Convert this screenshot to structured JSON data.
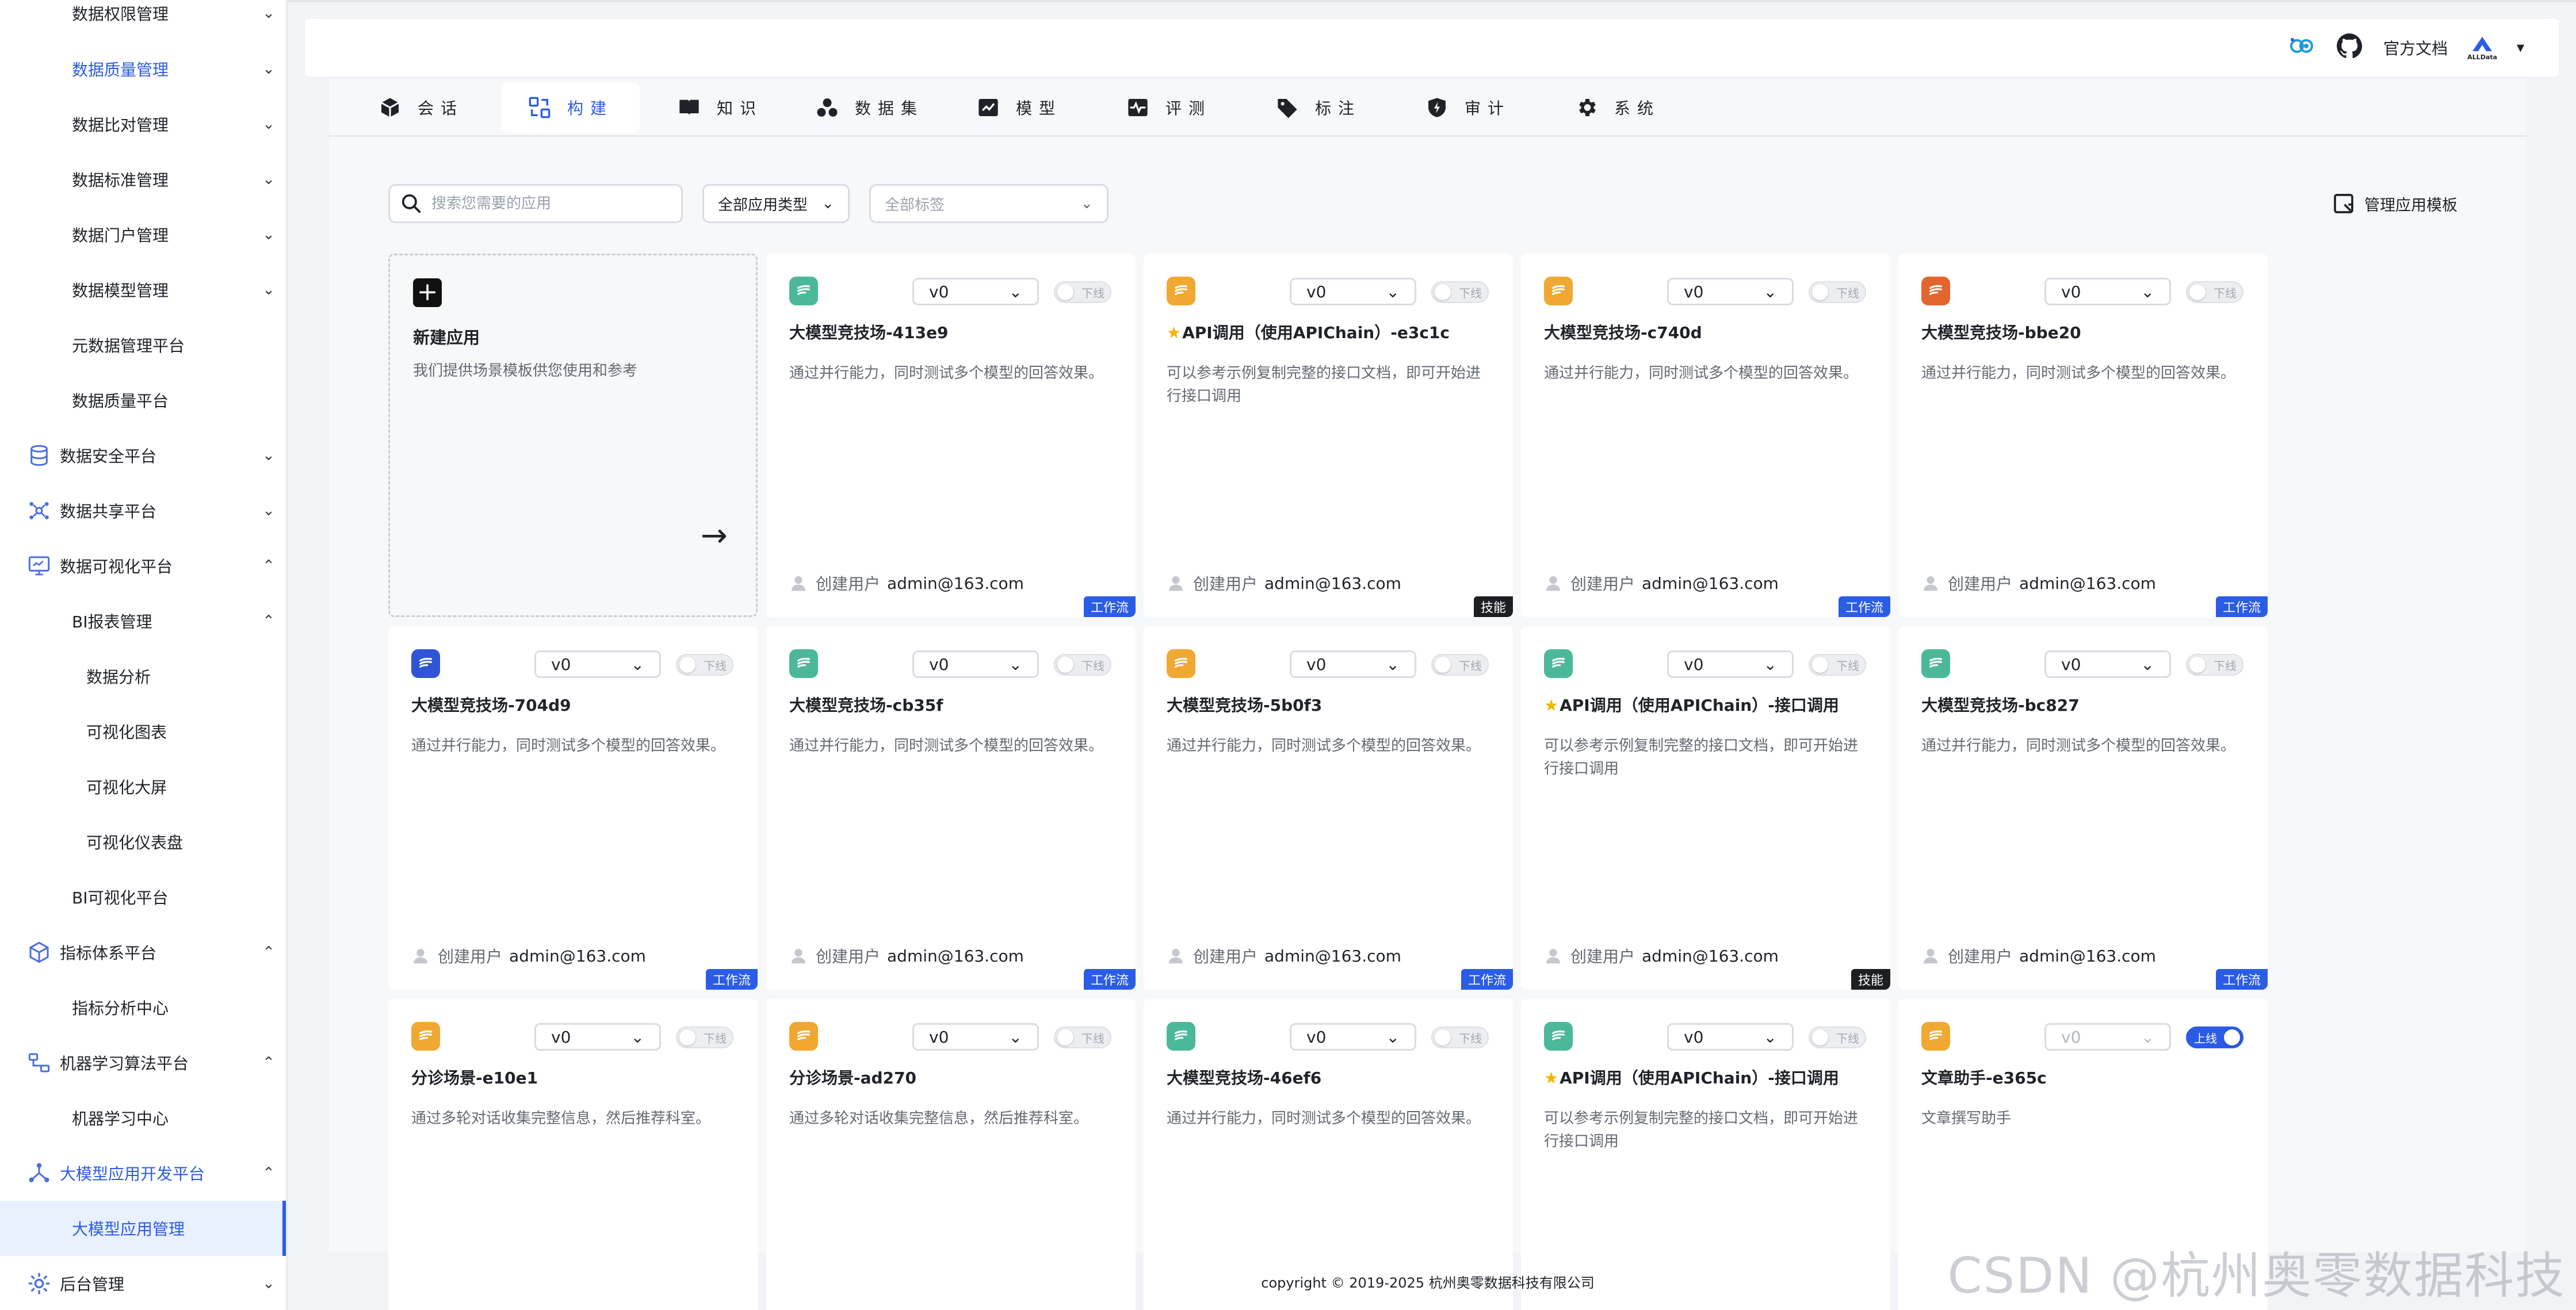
{
  "sidebar": {
    "items": [
      {
        "label": "数据权限管理",
        "level": "sub",
        "chevron": "down"
      },
      {
        "label": "数据质量管理",
        "level": "sub",
        "chevron": "down",
        "highlight": true
      },
      {
        "label": "数据比对管理",
        "level": "sub",
        "chevron": "down"
      },
      {
        "label": "数据标准管理",
        "level": "sub",
        "chevron": "down"
      },
      {
        "label": "数据门户管理",
        "level": "sub",
        "chevron": "down"
      },
      {
        "label": "数据模型管理",
        "level": "sub",
        "chevron": "down"
      },
      {
        "label": "元数据管理平台",
        "level": "sub"
      },
      {
        "label": "数据质量平台",
        "level": "sub"
      },
      {
        "label": "数据安全平台",
        "level": "top",
        "icon": "database-icon",
        "chevron": "down"
      },
      {
        "label": "数据共享平台",
        "level": "top",
        "icon": "network-icon",
        "chevron": "down"
      },
      {
        "label": "数据可视化平台",
        "level": "top",
        "icon": "monitor-icon",
        "chevron": "up"
      },
      {
        "label": "BI报表管理",
        "level": "sub",
        "chevron": "up"
      },
      {
        "label": "数据分析",
        "level": "sub2"
      },
      {
        "label": "可视化图表",
        "level": "sub2"
      },
      {
        "label": "可视化大屏",
        "level": "sub2"
      },
      {
        "label": "可视化仪表盘",
        "level": "sub2"
      },
      {
        "label": "BI可视化平台",
        "level": "sub"
      },
      {
        "label": "指标体系平台",
        "level": "top",
        "icon": "cube-icon",
        "chevron": "up"
      },
      {
        "label": "指标分析中心",
        "level": "sub"
      },
      {
        "label": "机器学习算法平台",
        "level": "top",
        "icon": "algorithm-icon",
        "chevron": "up"
      },
      {
        "label": "机器学习中心",
        "level": "sub"
      },
      {
        "label": "大模型应用开发平台",
        "level": "top",
        "icon": "nodes-icon",
        "chevron": "up",
        "highlight": true
      },
      {
        "label": "大模型应用管理",
        "level": "sub",
        "active": true
      },
      {
        "label": "后台管理",
        "level": "top",
        "icon": "settings-icon",
        "chevron": "down"
      }
    ]
  },
  "header": {
    "docs_label": "官方文档",
    "logo_text": "ALLData",
    "menu_arrow": "▾"
  },
  "tabs": [
    {
      "label": "会话",
      "icon": "cube-icon"
    },
    {
      "label": "构建",
      "icon": "build-icon",
      "active": true
    },
    {
      "label": "知识",
      "icon": "book-icon"
    },
    {
      "label": "数据集",
      "icon": "dataset-icon"
    },
    {
      "label": "模型",
      "icon": "model-icon"
    },
    {
      "label": "评测",
      "icon": "pulse-icon"
    },
    {
      "label": "标注",
      "icon": "tag-icon"
    },
    {
      "label": "审计",
      "icon": "shield-icon"
    },
    {
      "label": "系统",
      "icon": "gear-icon"
    }
  ],
  "filters": {
    "search_placeholder": "搜索您需要的应用",
    "type_select": "全部应用类型",
    "tag_select": "全部标签",
    "manage_label": "管理应用模板"
  },
  "new_card": {
    "title": "新建应用",
    "desc": "我们提供场景模板供您使用和参考",
    "plus": "+",
    "arrow": "→"
  },
  "card_common": {
    "creator_label": "创建用户",
    "toggle_off": "下线",
    "toggle_on": "上线",
    "chevron": "⌄"
  },
  "cards": [
    {
      "title": "大模型竞技场-413e9",
      "star": "",
      "desc": "通过并行能力，同时测试多个模型的回答效果。",
      "version": "v0",
      "status": "下线",
      "on": false,
      "creator": "admin@163.com",
      "badge": "工作流",
      "badge_dark": false,
      "icon_color": "#4bb89a"
    },
    {
      "title": "API调用（使用APIChain）-e3c1c",
      "star": "★",
      "desc": "可以参考示例复制完整的接口文档，即可开始进行接口调用",
      "version": "v0",
      "status": "下线",
      "on": false,
      "creator": "admin@163.com",
      "badge": "技能",
      "badge_dark": true,
      "icon_color": "#f0a832"
    },
    {
      "title": "大模型竞技场-c740d",
      "star": "",
      "desc": "通过并行能力，同时测试多个模型的回答效果。",
      "version": "v0",
      "status": "下线",
      "on": false,
      "creator": "admin@163.com",
      "badge": "工作流",
      "badge_dark": false,
      "icon_color": "#f0a832"
    },
    {
      "title": "大模型竞技场-bbe20",
      "star": "",
      "desc": "通过并行能力，同时测试多个模型的回答效果。",
      "version": "v0",
      "status": "下线",
      "on": false,
      "creator": "admin@163.com",
      "badge": "工作流",
      "badge_dark": false,
      "icon_color": "#e2652e"
    },
    {
      "title": "大模型竞技场-704d9",
      "star": "",
      "desc": "通过并行能力，同时测试多个模型的回答效果。",
      "version": "v0",
      "status": "下线",
      "on": false,
      "creator": "admin@163.com",
      "badge": "工作流",
      "badge_dark": false,
      "icon_color": "#2f55d4"
    },
    {
      "title": "大模型竞技场-cb35f",
      "star": "",
      "desc": "通过并行能力，同时测试多个模型的回答效果。",
      "version": "v0",
      "status": "下线",
      "on": false,
      "creator": "admin@163.com",
      "badge": "工作流",
      "badge_dark": false,
      "icon_color": "#4bb89a"
    },
    {
      "title": "大模型竞技场-5b0f3",
      "star": "",
      "desc": "通过并行能力，同时测试多个模型的回答效果。",
      "version": "v0",
      "status": "下线",
      "on": false,
      "creator": "admin@163.com",
      "badge": "工作流",
      "badge_dark": false,
      "icon_color": "#f0a832"
    },
    {
      "title": "API调用（使用APIChain）-接口调用",
      "star": "★",
      "desc": "可以参考示例复制完整的接口文档，即可开始进行接口调用",
      "version": "v0",
      "status": "下线",
      "on": false,
      "creator": "admin@163.com",
      "badge": "技能",
      "badge_dark": true,
      "icon_color": "#4bb89a"
    },
    {
      "title": "大模型竞技场-bc827",
      "star": "",
      "desc": "通过并行能力，同时测试多个模型的回答效果。",
      "version": "v0",
      "status": "下线",
      "on": false,
      "creator": "admin@163.com",
      "badge": "工作流",
      "badge_dark": false,
      "icon_color": "#4bb89a"
    },
    {
      "title": "分诊场景-e10e1",
      "star": "",
      "desc": "通过多轮对话收集完整信息，然后推荐科室。",
      "version": "v0",
      "status": "下线",
      "on": false,
      "creator": "",
      "badge": "",
      "badge_dark": false,
      "icon_color": "#f0a832"
    },
    {
      "title": "分诊场景-ad270",
      "star": "",
      "desc": "通过多轮对话收集完整信息，然后推荐科室。",
      "version": "v0",
      "status": "下线",
      "on": false,
      "creator": "",
      "badge": "",
      "badge_dark": false,
      "icon_color": "#f0a832"
    },
    {
      "title": "大模型竞技场-46ef6",
      "star": "",
      "desc": "通过并行能力，同时测试多个模型的回答效果。",
      "version": "v0",
      "status": "下线",
      "on": false,
      "creator": "",
      "badge": "",
      "badge_dark": false,
      "icon_color": "#4bb89a"
    },
    {
      "title": "API调用（使用APIChain）-接口调用",
      "star": "★",
      "desc": "可以参考示例复制完整的接口文档，即可开始进行接口调用",
      "version": "v0",
      "status": "下线",
      "on": false,
      "creator": "",
      "badge": "",
      "badge_dark": false,
      "icon_color": "#4bb89a"
    },
    {
      "title": "文章助手-e365c",
      "star": "",
      "desc": "文章撰写助手",
      "version": "v0",
      "status": "上线",
      "on": true,
      "creator": "",
      "badge": "",
      "badge_dark": false,
      "icon_color": "#f0a832"
    }
  ],
  "footer": {
    "copyright": "copyright © 2019-2025 杭州奥零数据科技有限公司"
  },
  "watermark": "CSDN @杭州奥零数据科技"
}
